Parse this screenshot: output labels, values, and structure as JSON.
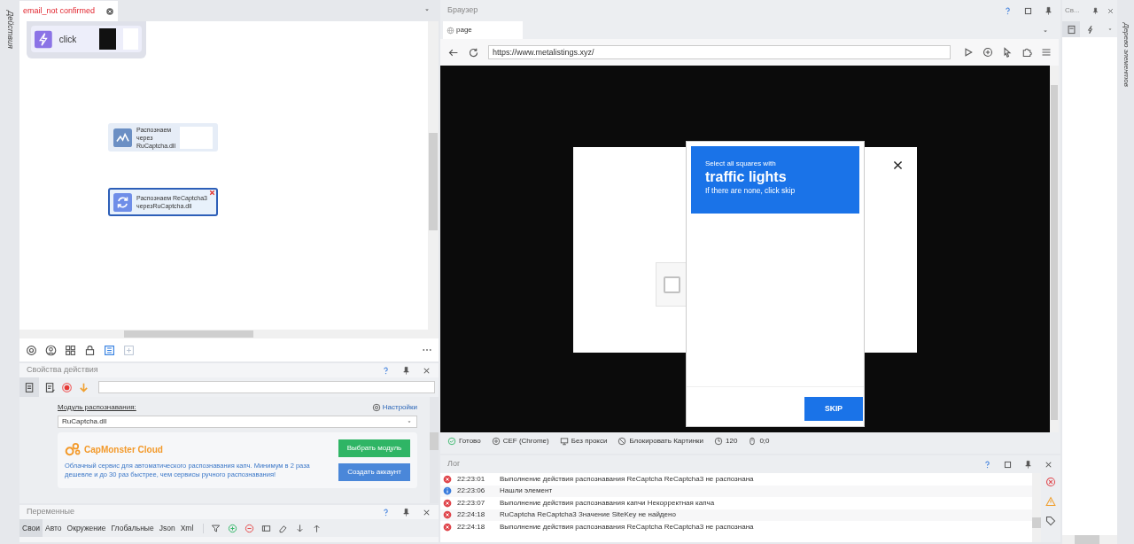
{
  "left_strip": {
    "label": "Действия"
  },
  "editor": {
    "tabs": [
      {
        "label": "email_not confirmed",
        "selected": true
      }
    ],
    "nodes": [
      {
        "kind": "click",
        "label": "click",
        "selected": false,
        "error": false
      },
      {
        "kind": "captcha",
        "label": "Распознаем через RuCaptcha.dll",
        "selected": false,
        "error": false
      },
      {
        "kind": "recaptcha",
        "label": "Распознаем ReCaptcha3 черезRuCaptcha.dll",
        "selected": true,
        "error": true
      }
    ]
  },
  "properties": {
    "title": "Свойства действия",
    "module_label": "Модуль распознавания:",
    "settings_link": "Настройки",
    "module_value": "RuCaptcha.dll",
    "ad": {
      "title": "CapMonster Cloud",
      "text": "Облачный сервис для автоматического распознавания капч. Минимум в 2 раза дешевле и до 30 раз быстрее, чем сервисы ручного распознавания!",
      "buttons": [
        {
          "kind": "green",
          "label": "Выбрать модуль"
        },
        {
          "kind": "blue",
          "label": "Создать аккаунт"
        }
      ]
    }
  },
  "variables": {
    "title": "Переменные",
    "tabs": [
      {
        "label": "Свои",
        "selected": true
      },
      {
        "label": "Авто",
        "selected": false
      },
      {
        "label": "Окружение",
        "selected": false
      },
      {
        "label": "Глобальные",
        "selected": false
      },
      {
        "label": "Json",
        "selected": false
      },
      {
        "label": "Xml",
        "selected": false
      }
    ]
  },
  "browser": {
    "title": "Браузер",
    "tabs": [
      {
        "label": "page",
        "selected": true
      }
    ],
    "url": "https://www.metalistings.xyz/",
    "captcha": {
      "checked": false,
      "prompt": "Select all squares with",
      "object": "traffic lights",
      "hint": "If there are none, click skip",
      "button": "SKIP"
    },
    "status": [
      {
        "kind": "ok",
        "label": "Готово"
      },
      {
        "kind": "engine",
        "label": "CEF (Chrome)"
      },
      {
        "kind": "proxy",
        "label": "Без прокси"
      },
      {
        "kind": "block",
        "label": "Блокировать Картинки"
      },
      {
        "kind": "clock",
        "label": "120"
      },
      {
        "kind": "mouse",
        "label": "0;0"
      }
    ]
  },
  "log": {
    "title": "Лог",
    "entries": [
      {
        "kind": "error",
        "time": "22:23:01",
        "text": "Выполнение действия распознавания ReCaptcha ReCaptcha3 не распознана"
      },
      {
        "kind": "info",
        "time": "22:23:06",
        "text": "Нашли элемент"
      },
      {
        "kind": "error",
        "time": "22:23:07",
        "text": "Выполнение действия распознавания капчи Некорректная капча"
      },
      {
        "kind": "error",
        "time": "22:24:18",
        "text": "RuCaptcha ReCaptcha3 Значение SiteKey не найдено"
      },
      {
        "kind": "error",
        "time": "22:24:18",
        "text": "Выполнение действия распознавания ReCaptcha ReCaptcha3 не распознана"
      }
    ]
  },
  "right_panel": {
    "title": "Св...",
    "strip_label": "Дерево элементов"
  }
}
